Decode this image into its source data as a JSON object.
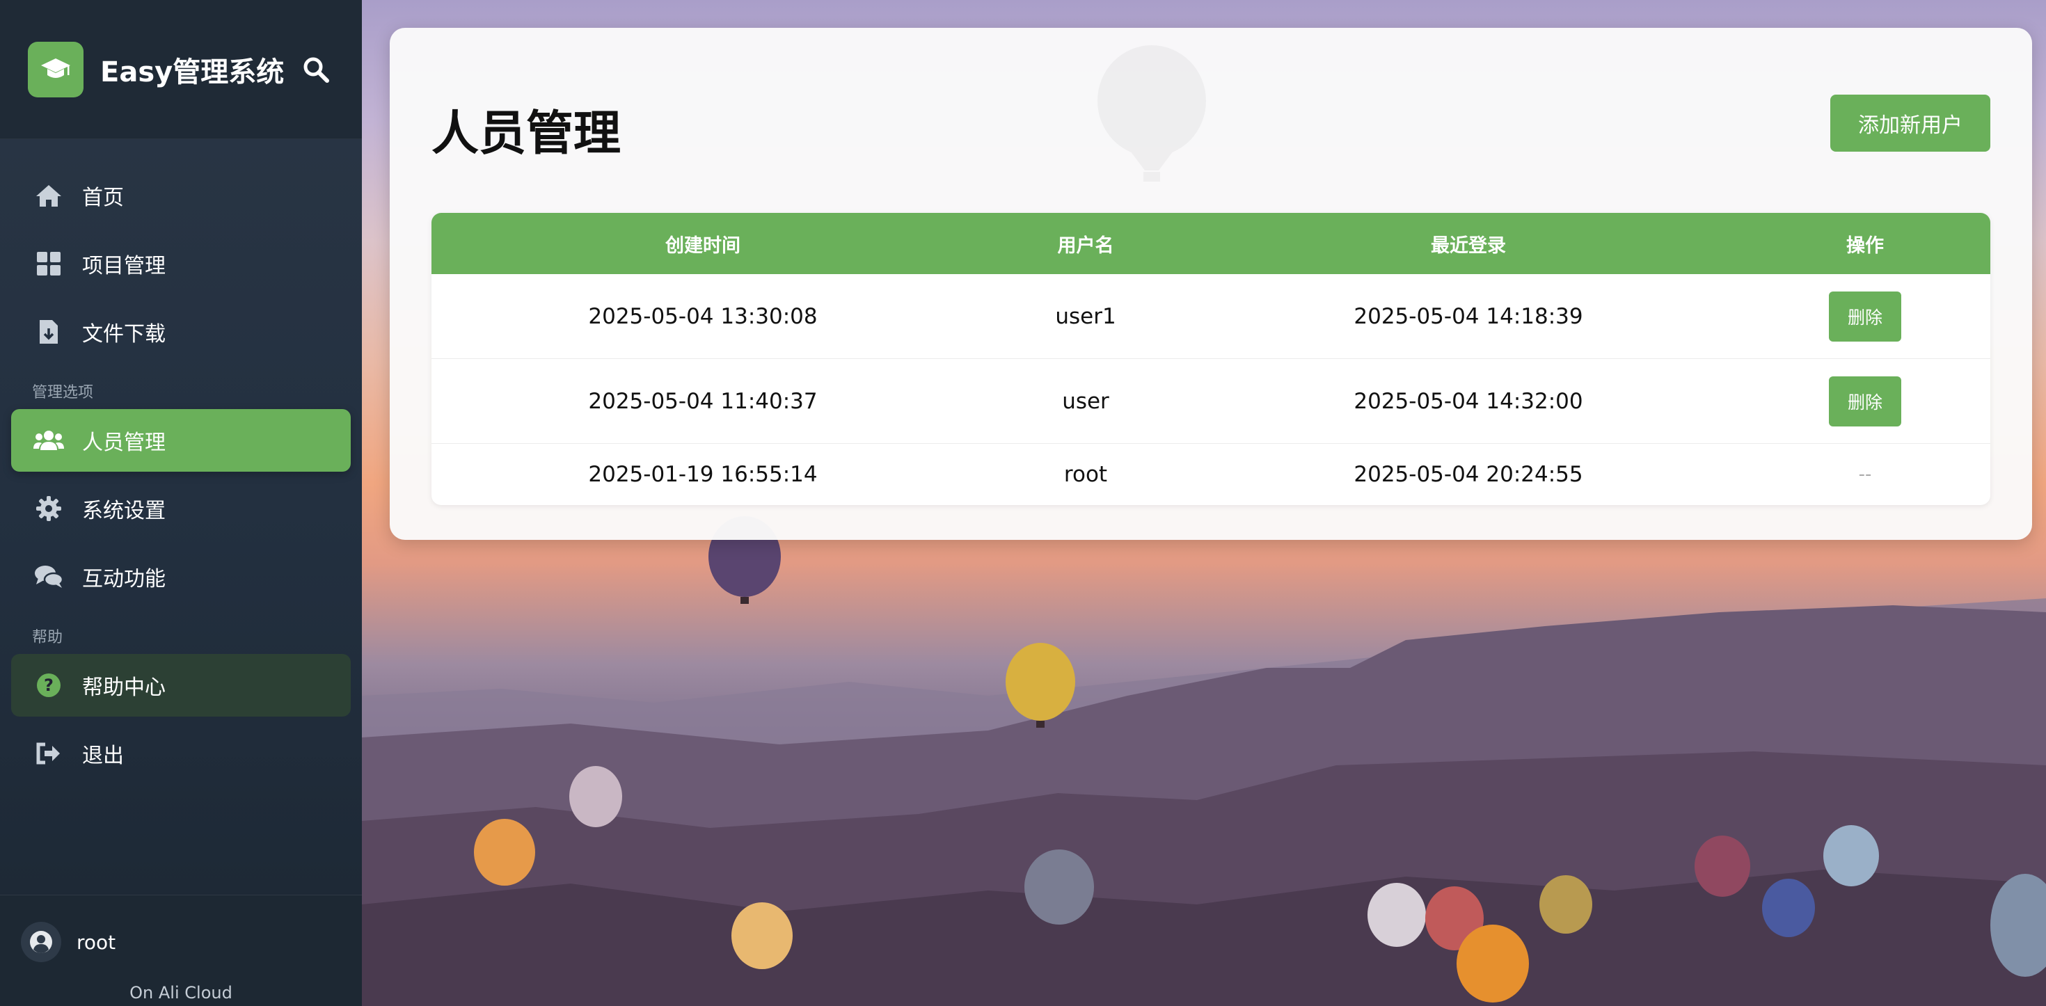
{
  "brand": {
    "title": "Easy管理系统"
  },
  "nav": {
    "items": [
      {
        "label": "首页",
        "icon": "home-icon"
      },
      {
        "label": "项目管理",
        "icon": "grid-icon"
      },
      {
        "label": "文件下载",
        "icon": "file-download-icon"
      }
    ],
    "admin_section": "管理选项",
    "admin_items": [
      {
        "label": "人员管理",
        "icon": "users-icon",
        "active": true
      },
      {
        "label": "系统设置",
        "icon": "gear-icon"
      },
      {
        "label": "互动功能",
        "icon": "chat-icon"
      }
    ],
    "help_section": "帮助",
    "help_items": [
      {
        "label": "帮助中心",
        "icon": "question-icon"
      },
      {
        "label": "退出",
        "icon": "logout-icon"
      }
    ]
  },
  "user": {
    "name": "root",
    "note": "On Ali Cloud"
  },
  "main": {
    "title": "人员管理",
    "add_button": "添加新用户",
    "table": {
      "headers": [
        "创建时间",
        "用户名",
        "最近登录",
        "操作"
      ],
      "rows": [
        {
          "created": "2025-05-04 13:30:08",
          "username": "user1",
          "last_login": "2025-05-04 14:18:39",
          "action": "删除"
        },
        {
          "created": "2025-05-04 11:40:37",
          "username": "user",
          "last_login": "2025-05-04 14:32:00",
          "action": "删除"
        },
        {
          "created": "2025-01-19 16:55:14",
          "username": "root",
          "last_login": "2025-05-04 20:24:55",
          "action": "--"
        }
      ]
    }
  },
  "colors": {
    "accent": "#6ab05a",
    "sidebar": "#233040"
  }
}
